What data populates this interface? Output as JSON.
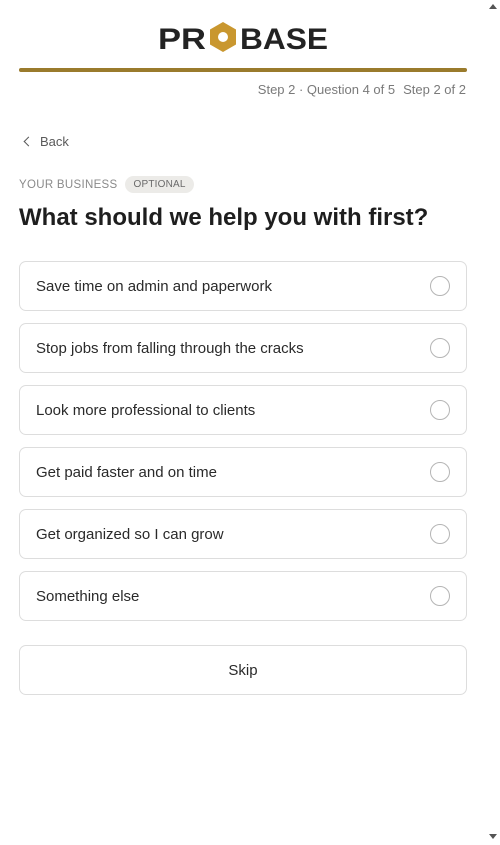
{
  "brand": {
    "logo_text": "PROBASE",
    "accent_color": "#9a7b2c",
    "logo_color": "#232323"
  },
  "progress": {
    "fraction": 1.0
  },
  "step": {
    "question_text": "Step 2 · Question 4 of 5",
    "step_text": "Step 2 of 2"
  },
  "nav": {
    "back_label": "Back"
  },
  "section": {
    "label": "YOUR BUSINESS",
    "badge": "OPTIONAL"
  },
  "question": {
    "title": "What should we help you with first?"
  },
  "options": [
    {
      "label": "Save time on admin and paperwork",
      "selected": false
    },
    {
      "label": "Stop jobs from falling through the cracks",
      "selected": false
    },
    {
      "label": "Look more professional to clients",
      "selected": false
    },
    {
      "label": "Get paid faster and on time",
      "selected": false
    },
    {
      "label": "Get organized so I can grow",
      "selected": false
    },
    {
      "label": "Something else",
      "selected": false
    }
  ],
  "actions": {
    "skip_label": "Skip"
  },
  "icons": {
    "back": "chevron-left-icon",
    "option": "radio-icon",
    "scroll_up": "scroll-up-arrow-icon",
    "scroll_down": "scroll-down-arrow-icon"
  }
}
